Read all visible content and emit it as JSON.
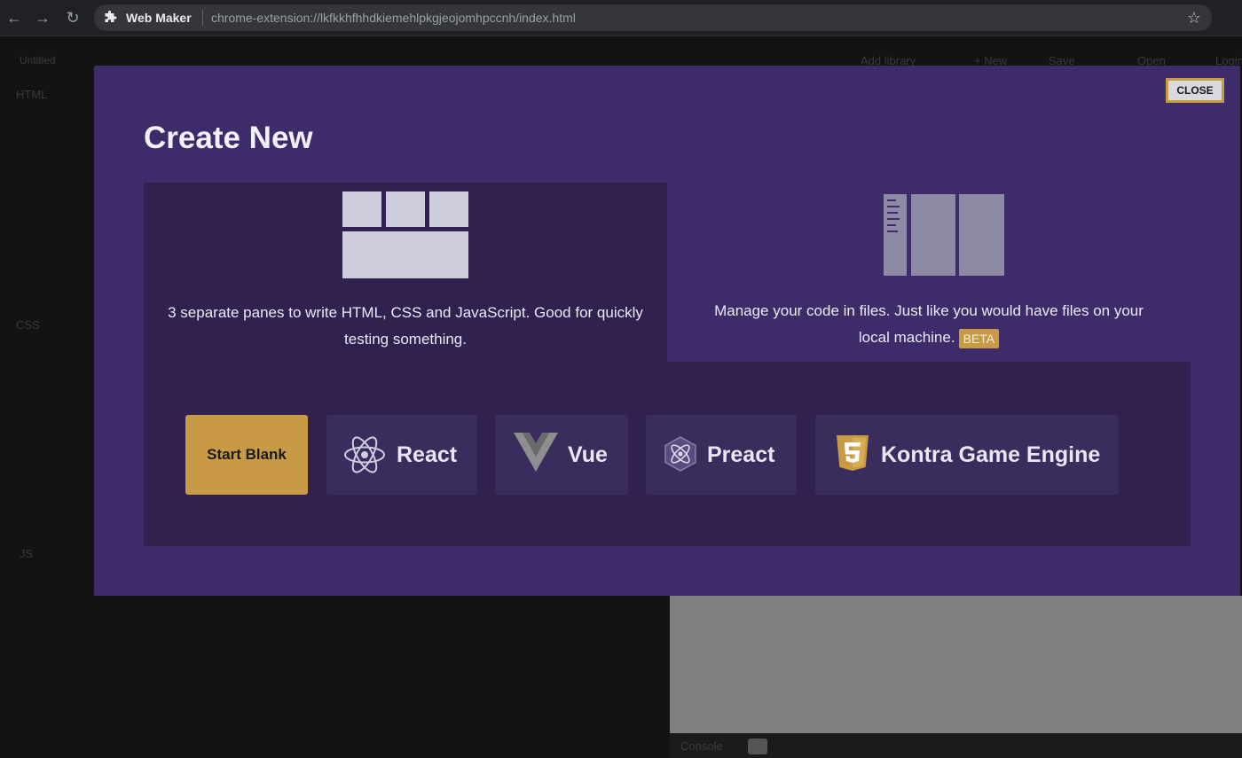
{
  "browser": {
    "site_name": "Web Maker",
    "url": "chrome-extension://lkfkkhfhhdkiemehlpkgjeojomhpccnh/index.html"
  },
  "background": {
    "title": "Untitled",
    "actions": [
      "Add library",
      "+ New",
      "Save",
      "Open",
      "Login"
    ],
    "panes": [
      "HTML",
      "CSS",
      "JS"
    ],
    "console_label": "Console"
  },
  "modal": {
    "close_label": "CLOSE",
    "title": "Create New",
    "modes": [
      {
        "description": "3 separate panes to write HTML, CSS and JavaScript. Good for quickly testing something.",
        "selected": true
      },
      {
        "description": "Manage your code in files. Just like you would have files on your local machine.",
        "badge": "BETA",
        "selected": false
      }
    ],
    "templates": [
      {
        "label": "Start Blank",
        "icon": null
      },
      {
        "label": "React",
        "icon": "react-icon"
      },
      {
        "label": "Vue",
        "icon": "vue-icon"
      },
      {
        "label": "Preact",
        "icon": "preact-icon"
      },
      {
        "label": "Kontra Game Engine",
        "icon": "html5-icon"
      }
    ]
  },
  "colors": {
    "modal_bg": "#3e2c6a",
    "panel_bg": "#30214f",
    "accent": "#c99a45",
    "template_bg": "#3a2c5c"
  }
}
